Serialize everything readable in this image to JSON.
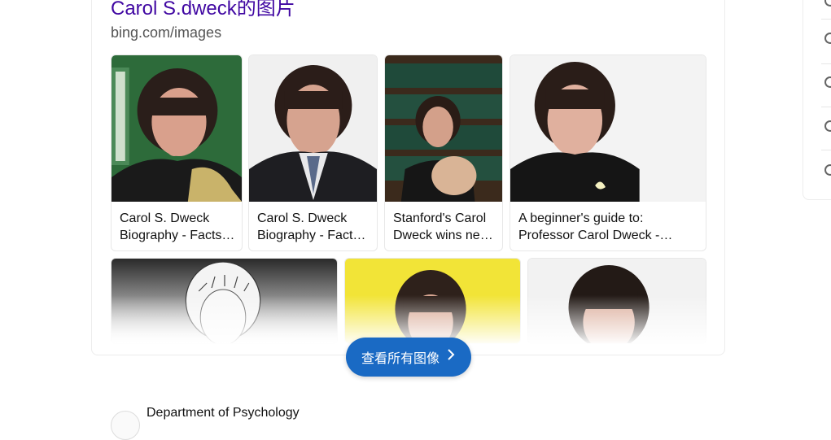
{
  "result": {
    "title": "Carol S.dweck的图片",
    "source": "bing.com/images"
  },
  "images": [
    {
      "line1": "Carol S. Dweck",
      "line2": "Biography - Facts…"
    },
    {
      "line1": "Carol S. Dweck",
      "line2": "Biography - Facts…"
    },
    {
      "line1": "Stanford's Carol",
      "line2": "Dweck wins ne…"
    },
    {
      "line1": "A beginner's guide to:",
      "line2": "Professor Carol Dweck -…"
    }
  ],
  "see_all": {
    "label": "查看所有图像",
    "icon": "chevron-right-icon"
  },
  "next_result": {
    "title": "Department of Psychology"
  },
  "side_panel": {
    "options": [
      "",
      "",
      "",
      "",
      ""
    ]
  }
}
